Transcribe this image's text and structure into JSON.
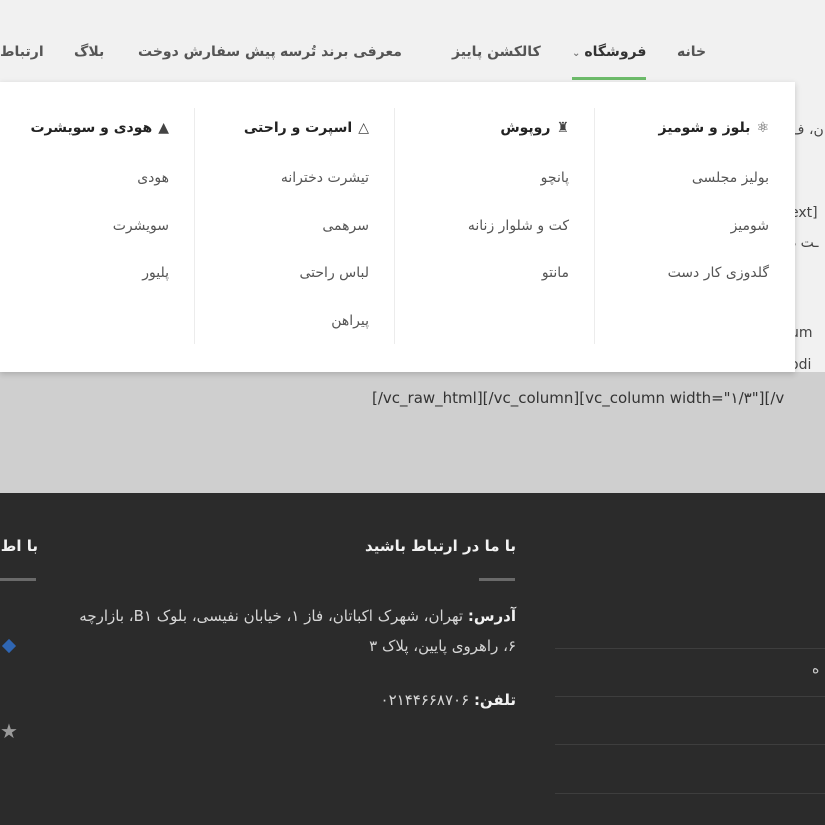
{
  "nav": {
    "items": [
      "خانه",
      "فروشگاه",
      "کالکشن پاییز",
      "معرفی برند تُرسه",
      "پیش سفارش دوخت",
      "بلاگ",
      "ارتباط"
    ]
  },
  "mega_menu": {
    "columns": [
      {
        "title": "بلوز و شومیز",
        "icon": "dress-icon",
        "links": [
          "بولیز مجلسی",
          "شومیز",
          "گلدوزی کار دست"
        ]
      },
      {
        "title": "روپوش",
        "icon": "coat-icon",
        "links": [
          "پانچو",
          "کت و شلوار زنانه",
          "مانتو"
        ]
      },
      {
        "title": "اسپرت و راحتی",
        "icon": "skirt-icon",
        "links": [
          "تیشرت دخترانه",
          "سرهمی",
          "لباس راحتی",
          "پیراهن"
        ]
      },
      {
        "title": "هودی و سویشرت",
        "icon": "hoodie-icon",
        "links": [
          "هودی",
          "سویشرت",
          "پلیور"
        ]
      }
    ]
  },
  "page": {
    "raw_line": "[/vc_raw_html][/vc_column][vc_column width=\"۱/۳\"][/v",
    "peek_1": "ان، ف",
    "peek_2": "ext]",
    "peek_3": "ـت د",
    "peek_4": "um",
    "peek_5": "odi"
  },
  "footer": {
    "contact_title": "با ما در ارتباط باشید",
    "second_title": "با اط",
    "address_label": "آدرس:",
    "address_text": " تهران، شهرک اکباتان، فاز ۱، خیابان نفیسی، بلوک B۱، بازارچه ۶، راهروی پایین، پلاک ۳",
    "phone_label": "تلفن:",
    "phone_text": " ۰۲۱۴۴۶۶۸۷۰۶",
    "peek": "ه"
  }
}
